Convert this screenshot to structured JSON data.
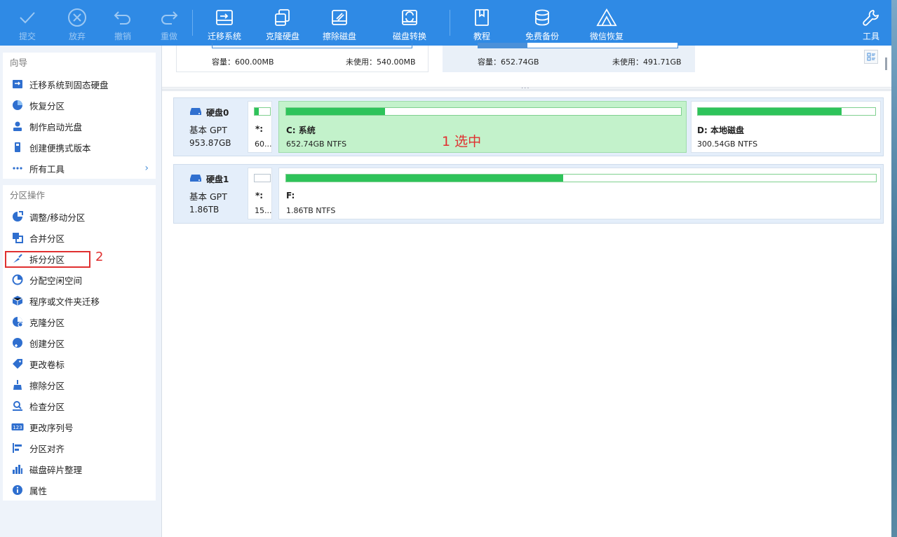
{
  "toolbar": {
    "buttons": [
      {
        "label": "提交",
        "icon": "check-icon"
      },
      {
        "label": "放弃",
        "icon": "cancel-icon"
      },
      {
        "label": "撤销",
        "icon": "undo-icon"
      },
      {
        "label": "重做",
        "icon": "redo-icon"
      },
      {
        "label": "迁移系统",
        "icon": "migrate-os-icon"
      },
      {
        "label": "克隆硬盘",
        "icon": "clone-disk-icon"
      },
      {
        "label": "擦除磁盘",
        "icon": "wipe-disk-icon"
      },
      {
        "label": "磁盘转换",
        "icon": "convert-disk-icon"
      },
      {
        "label": "教程",
        "icon": "book-icon"
      },
      {
        "label": "免费备份",
        "icon": "backup-icon"
      },
      {
        "label": "微信恢复",
        "icon": "wechat-recovery-icon"
      },
      {
        "label": "工具",
        "icon": "wrench-icon"
      }
    ]
  },
  "sidebar": {
    "wizard_title": "向导",
    "wizard_items": [
      {
        "label": "迁移系统到固态硬盘",
        "icon": "migrate-ssd-icon"
      },
      {
        "label": "恢复分区",
        "icon": "recover-partition-icon"
      },
      {
        "label": "制作启动光盘",
        "icon": "boot-disc-icon"
      },
      {
        "label": "创建便携式版本",
        "icon": "portable-icon"
      },
      {
        "label": "所有工具",
        "icon": "more-dots-icon"
      }
    ],
    "ops_title": "分区操作",
    "ops_items": [
      {
        "label": "调整/移动分区",
        "icon": "resize-icon"
      },
      {
        "label": "合并分区",
        "icon": "merge-icon"
      },
      {
        "label": "拆分分区",
        "icon": "split-icon"
      },
      {
        "label": "分配空闲空间",
        "icon": "allocate-icon"
      },
      {
        "label": "程序或文件夹迁移",
        "icon": "app-migrate-icon"
      },
      {
        "label": "克隆分区",
        "icon": "clone-partition-icon"
      },
      {
        "label": "创建分区",
        "icon": "create-partition-icon"
      },
      {
        "label": "更改卷标",
        "icon": "label-tag-icon"
      },
      {
        "label": "擦除分区",
        "icon": "wipe-partition-icon"
      },
      {
        "label": "检查分区",
        "icon": "check-partition-icon"
      },
      {
        "label": "更改序列号",
        "icon": "serial-number-icon"
      },
      {
        "label": "分区对齐",
        "icon": "align-icon"
      },
      {
        "label": "磁盘碎片整理",
        "icon": "defrag-icon"
      },
      {
        "label": "属性",
        "icon": "info-icon"
      }
    ],
    "annotation": "2"
  },
  "top_cards": [
    {
      "capacity": "容量：600.00MB",
      "unused": "未使用：540.00MB"
    },
    {
      "capacity": "容量：652.74GB",
      "unused": "未使用：491.71GB"
    }
  ],
  "disks": [
    {
      "name": "硬盘0",
      "type": "基本 GPT",
      "size": "953.87GB",
      "partitions": [
        {
          "name": "*:",
          "info": "60...",
          "used_fraction": 0.25
        },
        {
          "name": "C: 系统",
          "info": "652.74GB NTFS",
          "used_fraction": 0.25
        },
        {
          "name": "D: 本地磁盘",
          "info": "300.54GB NTFS",
          "used_fraction": 0.81
        }
      ]
    },
    {
      "name": "硬盘1",
      "type": "基本 GPT",
      "size": "1.86TB",
      "partitions": [
        {
          "name": "*:",
          "info": "15...",
          "used_fraction": 0.0
        },
        {
          "name": "F:",
          "info": "1.86TB NTFS",
          "used_fraction": 0.47
        }
      ]
    }
  ],
  "selection_annotation": "1 选中",
  "colors": {
    "toolbar": "#2f8ae5",
    "selected_partition": "#c3f2cb",
    "used_bar": "#2ec35a",
    "annotation": "#e03030"
  }
}
